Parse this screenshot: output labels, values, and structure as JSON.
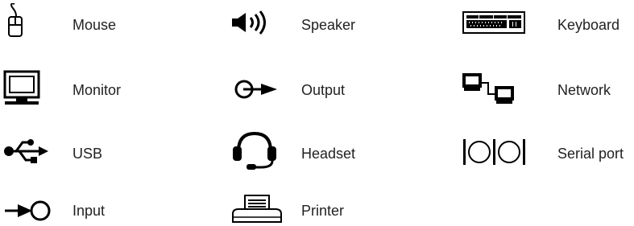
{
  "legend": {
    "items": [
      {
        "label": "Mouse",
        "icon": "mouse-icon"
      },
      {
        "label": "Speaker",
        "icon": "speaker-icon"
      },
      {
        "label": "Keyboard",
        "icon": "keyboard-icon"
      },
      {
        "label": "Monitor",
        "icon": "monitor-icon"
      },
      {
        "label": "Output",
        "icon": "output-icon"
      },
      {
        "label": "Network",
        "icon": "network-icon"
      },
      {
        "label": "USB",
        "icon": "usb-icon"
      },
      {
        "label": "Headset",
        "icon": "headset-icon"
      },
      {
        "label": "Serial port",
        "icon": "serial-port-icon"
      },
      {
        "label": "Input",
        "icon": "input-icon"
      },
      {
        "label": "Printer",
        "icon": "printer-icon"
      }
    ]
  },
  "colors": {
    "icon": "#000000",
    "text": "#222222"
  }
}
